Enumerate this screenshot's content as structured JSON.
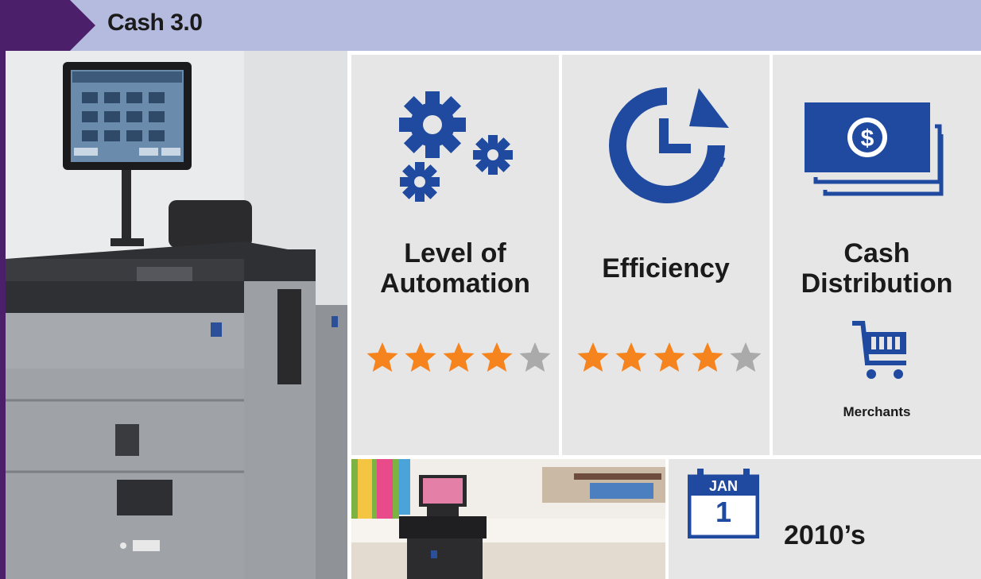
{
  "header": {
    "title": "Cash 3.0"
  },
  "panels": [
    {
      "title_line1": "Level of",
      "title_line2": "Automation",
      "rating": 4,
      "max_rating": 5,
      "icon": "gears-icon"
    },
    {
      "title": "Efficiency",
      "rating": 4,
      "max_rating": 5,
      "icon": "clock-refresh-icon"
    },
    {
      "title_line1": "Cash",
      "title_line2": "Distribution",
      "icon": "cash-bills-icon",
      "sub_icon": "shopping-cart-icon",
      "sub_label": "Merchants"
    }
  ],
  "calendar": {
    "month": "JAN",
    "day": "1",
    "era": "2010’s"
  },
  "colors": {
    "accent_blue": "#1f4aa0",
    "star_on": "#f5841f",
    "star_off": "#aaaaaa",
    "header_bg": "#b4bbdf",
    "header_tab": "#4b1f6a"
  }
}
